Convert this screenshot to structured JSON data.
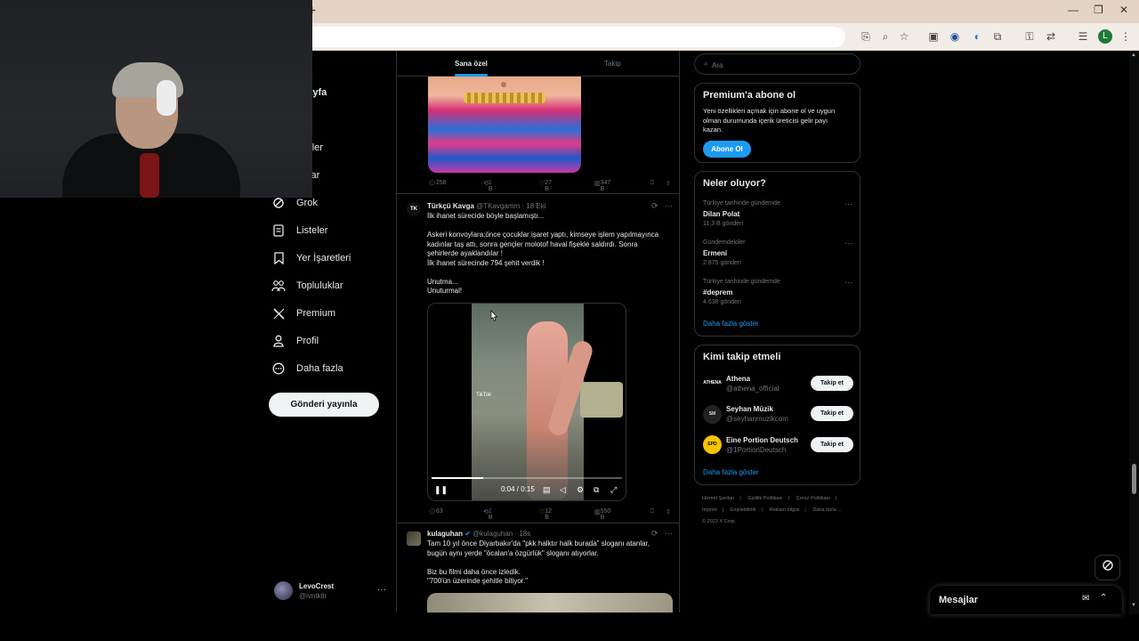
{
  "browser": {
    "new_tab": "+",
    "minimize": "—",
    "restore": "❐",
    "close": "✕",
    "profile_initial": "L",
    "toolbar_icons": [
      "install-icon",
      "zoom-icon",
      "star-icon",
      "extension-puzzle-icon",
      "extension-icon",
      "audio-icon",
      "extensions-icon",
      "password-key-icon",
      "translate-icon",
      "reading-list-icon",
      "menu-kebab-icon"
    ]
  },
  "nav": {
    "items": [
      {
        "label": "asayfa",
        "icon": "home-icon"
      },
      {
        "label": "fet",
        "icon": "explore-icon"
      },
      {
        "label": "irimler",
        "icon": "bell-icon"
      },
      {
        "label": "sajlar",
        "icon": "mail-icon"
      },
      {
        "label": "Grok",
        "icon": "grok-icon"
      },
      {
        "label": "Listeler",
        "icon": "list-icon"
      },
      {
        "label": "Yer İşaretleri",
        "icon": "bookmark-icon"
      },
      {
        "label": "Topluluklar",
        "icon": "communities-icon"
      },
      {
        "label": "Premium",
        "icon": "x-logo-icon"
      },
      {
        "label": "Profil",
        "icon": "person-icon"
      },
      {
        "label": "Daha fazla",
        "icon": "more-circle-icon"
      }
    ],
    "post_button": "Gönderi yayınla",
    "account": {
      "name": "LevoCrest",
      "handle": "@ivntktlr",
      "more": "···"
    }
  },
  "timeline": {
    "tabs": [
      {
        "label": "Sana özel",
        "active": true
      },
      {
        "label": "Takip",
        "active": false
      }
    ],
    "tweet0_actions": {
      "replies": "258",
      "retweets": "1 B",
      "likes": "27 B",
      "views": "347 B"
    },
    "tweet1": {
      "name": "Türkçü Kavga",
      "handle": "@TKavgamm",
      "time": "· 18 Eki",
      "avatar_text": "TK",
      "lines": [
        "İlk ihanet sürecide böyle başlamıştı...",
        "",
        "Askeri konvoylara;önce çocuklar işaret yaptı, kimseye işlem yapılmayınca",
        "kadınlar taş attı, sonra gençler molotof havai fişekle saldırdı. Sonra",
        "şehirlerde ayaklandılar !",
        "İlk ihanet sürecinde 794 şehit verdik !",
        "",
        "Unutma...",
        "Unuturmal!"
      ],
      "video": {
        "watermark": "TikTok",
        "time": "0:04 / 0:15",
        "progress": 0.27
      },
      "actions": {
        "replies": "63",
        "retweets": "1 B",
        "likes": "12 B",
        "views": "550 B"
      }
    },
    "tweet2": {
      "name": "kulaguhan",
      "handle": "@kulaguhan",
      "time": "· 18s",
      "verified": true,
      "lines": [
        "Tam 10 yıl önce Diyarbakır'da \"pkk halktır halk burada\" sloganı atanlar,",
        "bugün aynı yerde \"öcalan'a özgürlük\" sloganı atıyorlar.",
        "",
        "Biz bu filmi daha önce izledik.",
        "\"700'ün üzerinde şehitle bitiyor.\""
      ]
    }
  },
  "sidebar": {
    "search_placeholder": "Ara",
    "premium": {
      "title": "Premium'a abone ol",
      "desc": [
        "Yeni özellikleri açmak için abone ol ve uygun",
        "olman durumunda içerik üreticisi gelir payı",
        "kazan."
      ],
      "button": "Abone Ol"
    },
    "trends": {
      "title": "Neler oluyor?",
      "items": [
        {
          "context": "Türkiye tarihinde gündemde",
          "name": "Dilan Polat",
          "count": "11,3 B gönderi"
        },
        {
          "context": "Gündemdekiler",
          "name": "Ermeni",
          "count": "2.875 gönderi"
        },
        {
          "context": "Türkiye tarihinde gündemde",
          "name": "#deprem",
          "count": "4.638 gönderi"
        }
      ],
      "more": "Daha fazla göster"
    },
    "who_to_follow": {
      "title": "Kimi takip etmeli",
      "items": [
        {
          "name": "Athena",
          "handle": "@athena_official",
          "avatar_text": "ATHENA",
          "button": "Takip et"
        },
        {
          "name": "Seyhan Müzik",
          "handle": "@seyhanmuzikcom",
          "avatar_text": "SM",
          "button": "Takip et"
        },
        {
          "name": "Eine Portion Deutsch",
          "handle": "@1PortionDeutsch",
          "avatar_text": "EPD",
          "button": "Takip et"
        }
      ],
      "more": "Daha fazla göster"
    },
    "footer": [
      "Hizmet Şartları",
      "|",
      "Gizlilik Politikası",
      "|",
      "Çerez Politikası",
      "|",
      "Imprint",
      "|",
      "Erişilebilirlik",
      "|",
      "Reklam bilgisi",
      "|",
      "Daha fazla ...",
      "© 2023 X Corp."
    ]
  },
  "messages": {
    "title": "Mesajlar"
  },
  "colors": {
    "accent": "#1d9bf0",
    "bg": "#000000",
    "border": "#2f3336",
    "muted": "#71767b",
    "chrome": "#e2d3c5"
  }
}
